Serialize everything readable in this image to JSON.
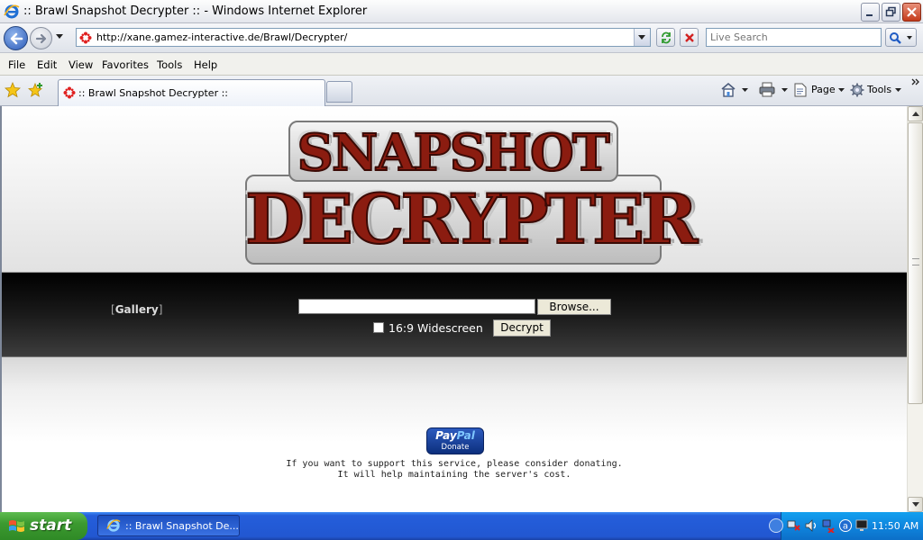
{
  "window": {
    "title": ":: Brawl Snapshot Decrypter :: - Windows Internet Explorer"
  },
  "address": {
    "url": "http://xane.gamez-interactive.de/Brawl/Decrypter/",
    "search_placeholder": "Live Search"
  },
  "menu": {
    "items": [
      "File",
      "Edit",
      "View",
      "Favorites",
      "Tools",
      "Help"
    ]
  },
  "tabs": {
    "active_label": ":: Brawl Snapshot Decrypter ::"
  },
  "commandbar": {
    "page_label": "Page",
    "tools_label": "Tools"
  },
  "page": {
    "logo_line1": "SNAPSHOT",
    "logo_line2": "DECRYPTER",
    "gallery_open": "[",
    "gallery_label": "Gallery",
    "gallery_close": "]",
    "browse_label": "Browse...",
    "widescreen_label": "16:9 Widescreen",
    "widescreen_checked": false,
    "decrypt_label": "Decrypt",
    "paypal_pay": "Pay",
    "paypal_pal": "Pal",
    "paypal_donate": "Donate",
    "donate_line1": "If you want to support this service, please consider donating.",
    "donate_line2": "It will help maintaining the server's cost."
  },
  "taskbar": {
    "start_label": "start",
    "task_label": ":: Brawl Snapshot De...",
    "clock": "11:50 AM"
  },
  "colors": {
    "taskbar_blue": "#245edb",
    "start_green": "#3c9a30",
    "logo_red": "#8b1c10",
    "band_black": "#000000"
  },
  "icons": [
    "ie-logo-icon",
    "minimize-icon",
    "maximize-icon",
    "close-icon",
    "back-arrow-icon",
    "forward-arrow-icon",
    "favicon-icon",
    "refresh-icon",
    "stop-icon",
    "search-icon",
    "favorites-star-icon",
    "add-favorite-icon",
    "home-icon",
    "print-icon",
    "page-icon",
    "gear-icon",
    "windows-flag-icon"
  ]
}
